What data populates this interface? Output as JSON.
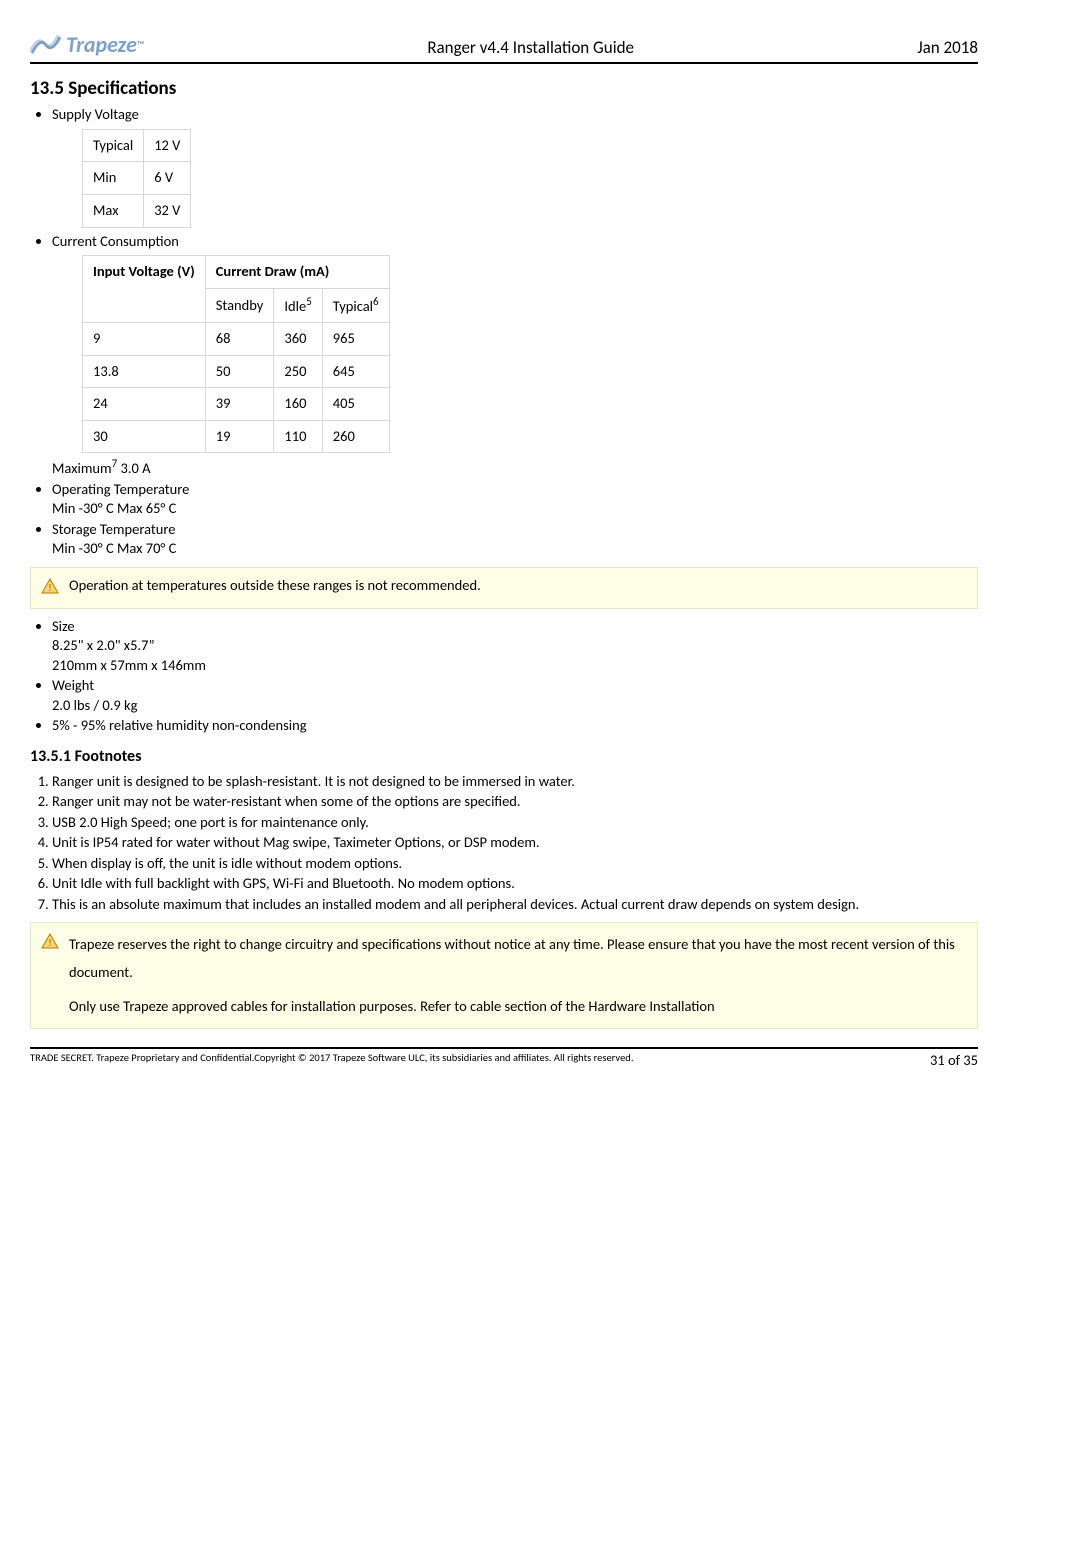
{
  "header": {
    "logo_text": "Trapeze",
    "center": "Ranger v4.4 Installation Guide",
    "right": "Jan 2018"
  },
  "section_title": "13.5 Specifications",
  "supply_voltage": {
    "label": "Supply Voltage",
    "rows": [
      {
        "label": "Typical",
        "value": "12 V"
      },
      {
        "label": "Min",
        "value": "6 V"
      },
      {
        "label": "Max",
        "value": "32 V"
      }
    ]
  },
  "current_consumption": {
    "label": "Current Consumption",
    "h_input": "Input Voltage (V)",
    "h_draw": "Current Draw (mA)",
    "h_standby": "Standby",
    "h_idle": "Idle",
    "h_idle_sup": "5",
    "h_typical": "Typical",
    "h_typical_sup": "6",
    "rows": [
      {
        "v": "9",
        "standby": "68",
        "idle": "360",
        "typical": "965"
      },
      {
        "v": "13.8",
        "standby": "50",
        "idle": "250",
        "typical": "645"
      },
      {
        "v": "24",
        "standby": "39",
        "idle": "160",
        "typical": "405"
      },
      {
        "v": "30",
        "standby": "19",
        "idle": "110",
        "typical": "260"
      }
    ],
    "max_label": "Maximum",
    "max_sup": "7",
    "max_val": " 3.0 A"
  },
  "op_temp": {
    "label": "Operating Temperature",
    "value": "Min -30° C Max 65° C"
  },
  "storage_temp": {
    "label": "Storage Temperature",
    "value": "Min -30° C Max 70° C"
  },
  "warn1": "Operation at temperatures outside these ranges is not recommended.",
  "size": {
    "label": "Size",
    "line1": "8.25\" x 2.0\" x5.7”",
    "line2": "210mm x 57mm x 146mm"
  },
  "weight": {
    "label": "Weight",
    "value": "2.0 lbs / 0.9 kg"
  },
  "humidity": "5% - 95% relative humidity non-condensing",
  "footnotes_title": "13.5.1  Footnotes",
  "footnotes": [
    "Ranger unit is designed to be splash-resistant. It is not designed to be immersed in water.",
    "Ranger unit may not be water-resistant when some of the options are specified.",
    "USB 2.0 High Speed; one port is for maintenance only.",
    "Unit is IP54 rated for water without Mag swipe, Taximeter Options, or DSP modem.",
    "When display is off, the unit is idle without modem options.",
    "Unit Idle with full backlight with GPS, Wi-Fi and Bluetooth. No modem options.",
    "This is an absolute maximum that includes an installed modem and all peripheral devices. Actual current draw depends on system design."
  ],
  "warn2": {
    "p1": "Trapeze reserves the right to change circuitry and specifications without notice at any time. Please ensure that you have the most recent version of this document.",
    "p2": "Only use Trapeze approved cables for installation purposes. Refer to cable section of the Hardware Installation"
  },
  "footer": {
    "left": "TRADE SECRET. Trapeze Proprietary and Confidential.Copyright © 2017 Trapeze Software ULC, its subsidiaries and affiliates. All rights reserved.",
    "page": "31 of 35"
  }
}
